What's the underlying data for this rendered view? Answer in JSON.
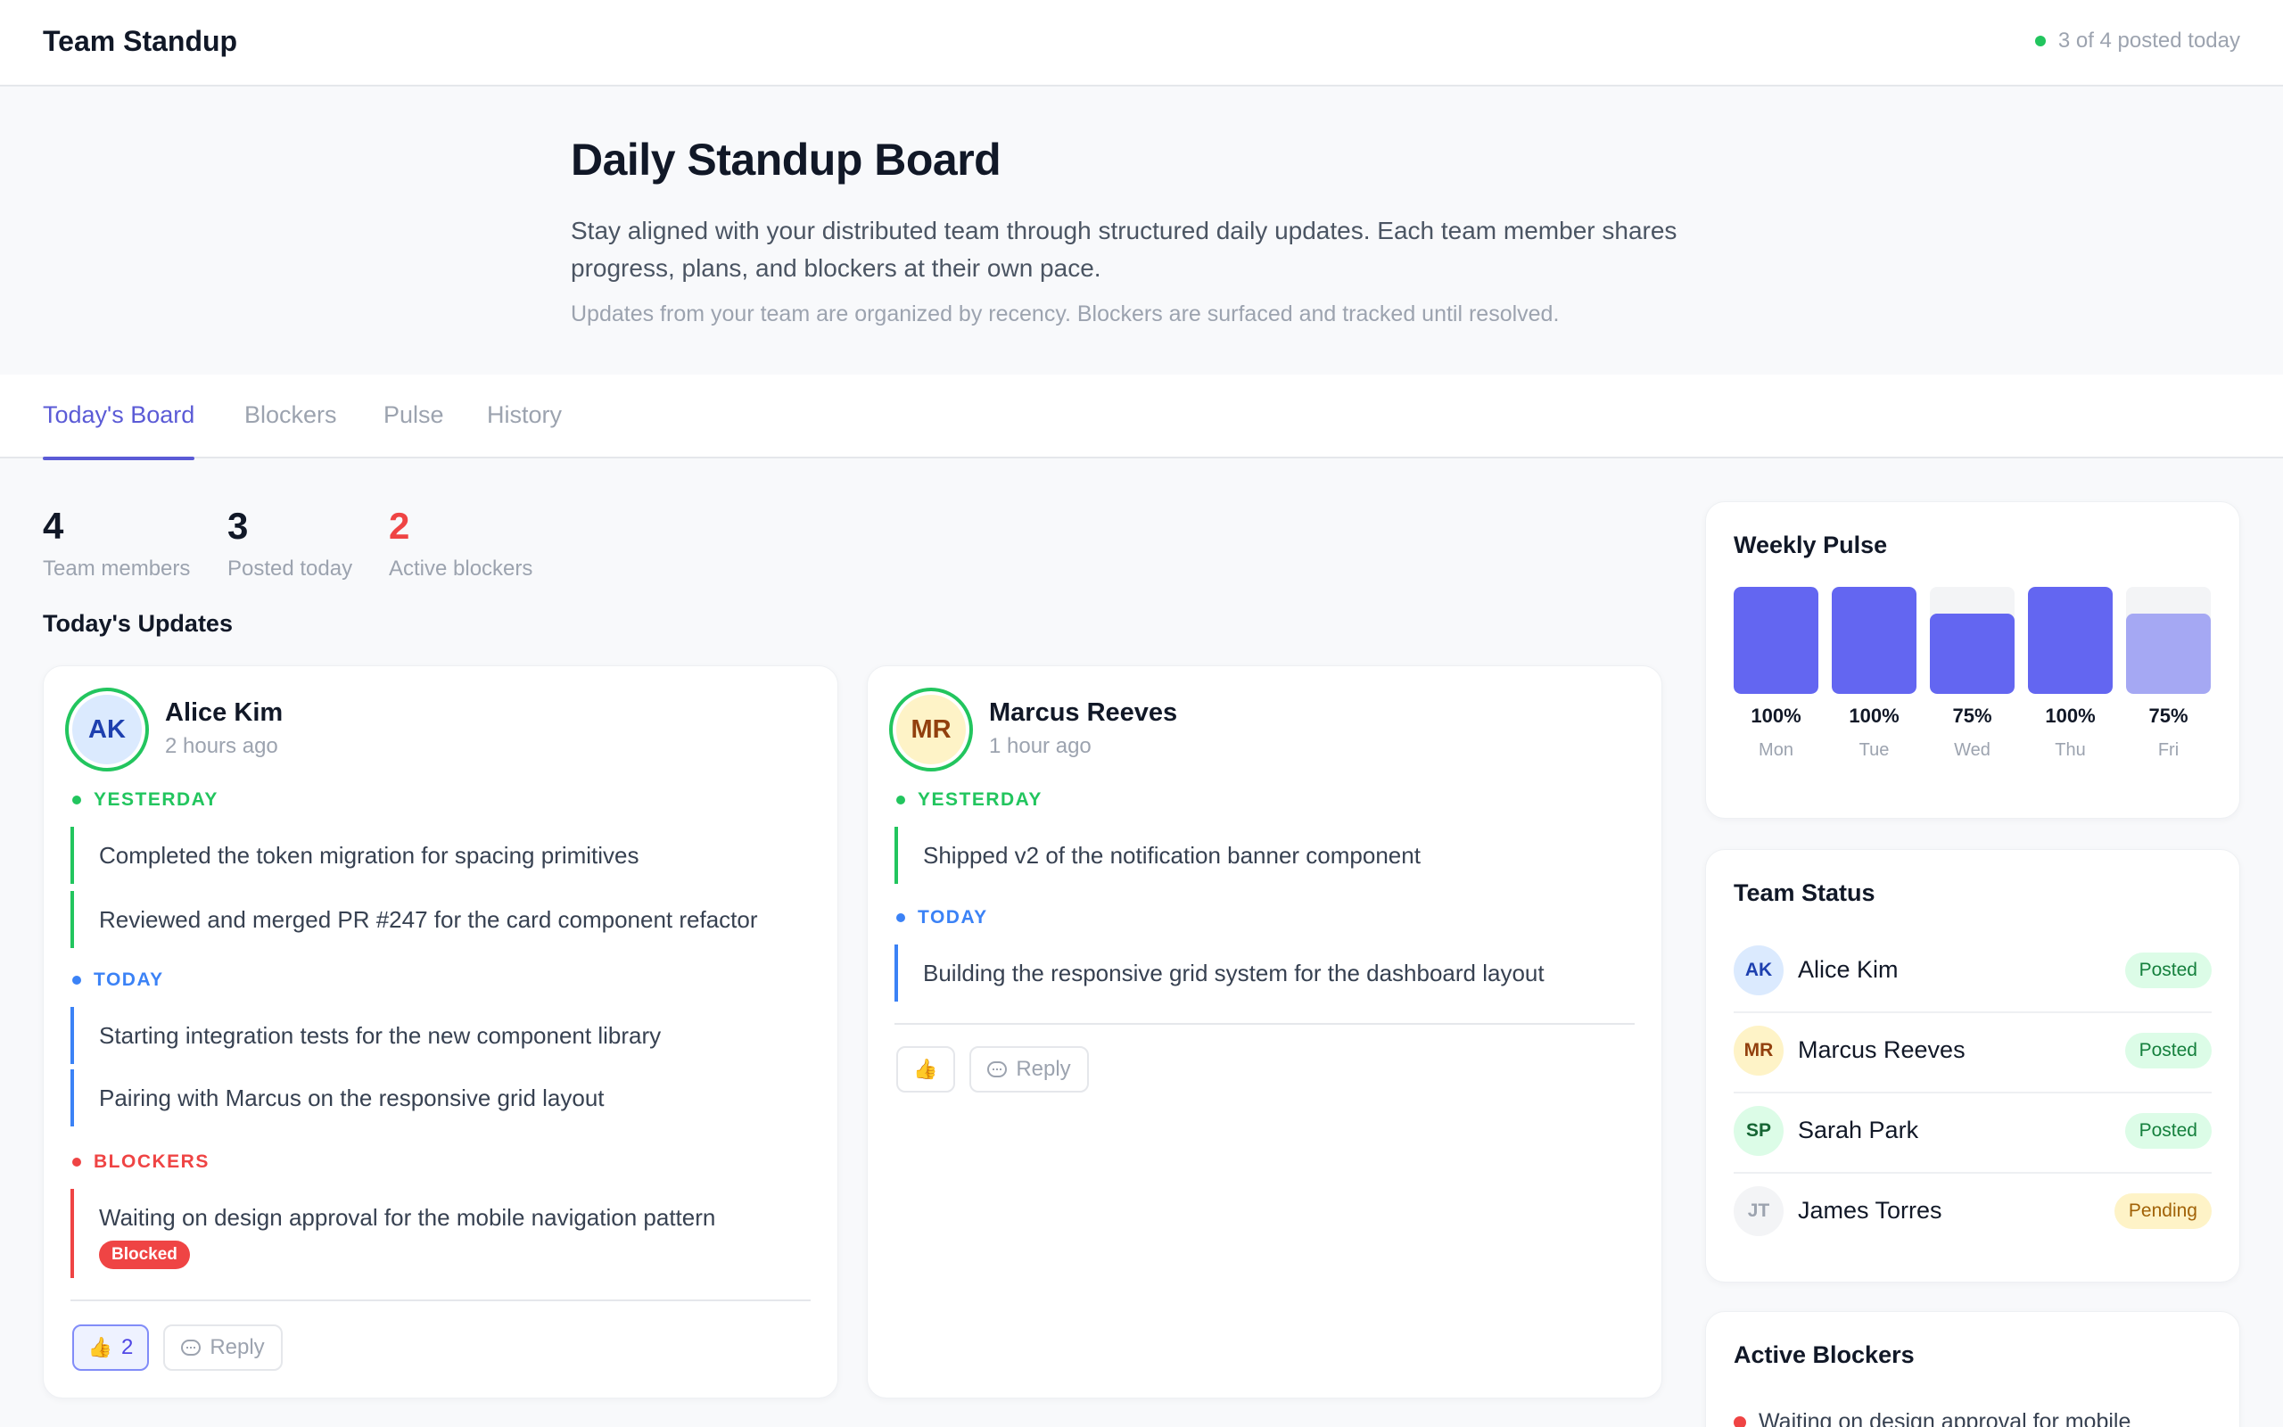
{
  "header": {
    "app_title": "Team Standup",
    "posted_status": "3 of 4 posted today"
  },
  "hero": {
    "title": "Daily Standup Board",
    "description": "Stay aligned with your distributed team through structured daily updates. Each team member shares progress, plans, and blockers at their own pace.",
    "note": "Updates from your team are organized by recency. Blockers are surfaced and tracked until resolved."
  },
  "tabs": [
    {
      "label": "Today's Board",
      "active": true
    },
    {
      "label": "Blockers",
      "active": false
    },
    {
      "label": "Pulse",
      "active": false
    },
    {
      "label": "History",
      "active": false
    }
  ],
  "stats": [
    {
      "value": "4",
      "label": "Team members"
    },
    {
      "value": "3",
      "label": "Posted today"
    },
    {
      "value": "2",
      "label": "Active blockers"
    }
  ],
  "updates_title": "Today's Updates",
  "cards": [
    {
      "initials": "AK",
      "name": "Alice Kim",
      "time": "2 hours ago",
      "yesterday_label": "YESTERDAY",
      "yesterday": [
        "Completed the token migration for spacing primitives",
        "Reviewed and merged PR #247 for the card component refactor"
      ],
      "today_label": "TODAY",
      "today": [
        "Starting integration tests for the new component library",
        "Pairing with Marcus on the responsive grid layout"
      ],
      "blockers_label": "BLOCKERS",
      "blockers": [
        {
          "text": "Waiting on design approval for the mobile navigation pattern",
          "badge": "Blocked"
        }
      ],
      "reaction_count": "2",
      "reply_label": "Reply"
    },
    {
      "initials": "MR",
      "name": "Marcus Reeves",
      "time": "1 hour ago",
      "yesterday_label": "YESTERDAY",
      "yesterday": [
        "Shipped v2 of the notification banner component"
      ],
      "today_label": "TODAY",
      "today": [
        "Building the responsive grid system for the dashboard layout"
      ],
      "reply_label": "Reply"
    }
  ],
  "weekly_pulse": {
    "title": "Weekly Pulse",
    "days": [
      {
        "day": "Mon",
        "pct": "100%",
        "value": 100
      },
      {
        "day": "Tue",
        "pct": "100%",
        "value": 100
      },
      {
        "day": "Wed",
        "pct": "75%",
        "value": 75
      },
      {
        "day": "Thu",
        "pct": "100%",
        "value": 100
      },
      {
        "day": "Fri",
        "pct": "75%",
        "value": 75
      }
    ],
    "colors": {
      "filled": "#6366f1",
      "today": "#a5a8f3",
      "track": "#f3f4f6"
    }
  },
  "team_status": {
    "title": "Team Status",
    "members": [
      {
        "initials": "AK",
        "name": "Alice Kim",
        "status": "Posted"
      },
      {
        "initials": "MR",
        "name": "Marcus Reeves",
        "status": "Posted"
      },
      {
        "initials": "SP",
        "name": "Sarah Park",
        "status": "Posted"
      },
      {
        "initials": "JT",
        "name": "James Torres",
        "status": "Pending"
      }
    ]
  },
  "active_blockers": {
    "title": "Active Blockers",
    "items": [
      "Waiting on design approval for mobile"
    ]
  },
  "icons": {
    "status_dot": "green-dot",
    "thumbs_up": "👍",
    "reply": "speech-bubble-icon"
  }
}
